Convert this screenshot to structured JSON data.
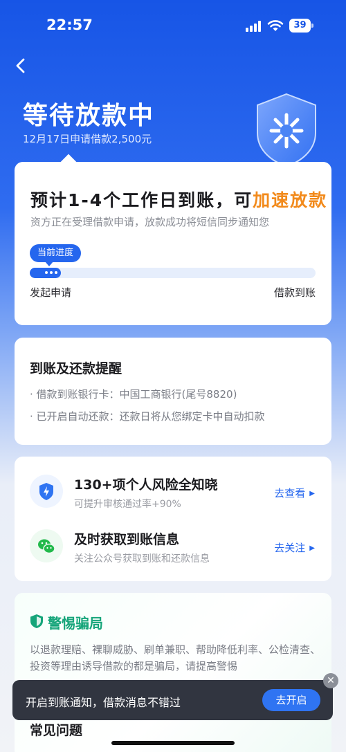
{
  "status_bar": {
    "time": "22:57",
    "battery": "39"
  },
  "header": {
    "title": "等待放款中",
    "subtitle": "12月17日申请借款2,500元"
  },
  "progress_card": {
    "headline": "预计1-4个工作日到账，可",
    "headline_accent": "加速放款",
    "description": "资方正在受理借款申请，放款成功将短信同步通知您",
    "current_label": "当前进度",
    "progress": 0.11,
    "stage_start": "发起申请",
    "stage_end": "借款到账"
  },
  "reminder_card": {
    "title": "到账及还款提醒",
    "items": [
      "· 借款到账银行卡：中国工商银行(尾号8820)",
      "· 已开启自动还款：还款日将从您绑定卡中自动扣款"
    ]
  },
  "service_card": {
    "rows": [
      {
        "icon": "shield-bolt-icon",
        "title": "130+项个人风险全知晓",
        "subtitle": "可提升审核通过率+90%",
        "link": "去查看"
      },
      {
        "icon": "wechat-icon",
        "title": "及时获取到账信息",
        "subtitle": "关注公众号获取到账和还款信息",
        "link": "去关注"
      }
    ]
  },
  "warning_card": {
    "title": "警惕骗局",
    "text": "以退款理赔、裸聊威胁、刷单兼职、帮助降低利率、公检清查、投资等理由诱导借款的都是骗局，请提高警惕"
  },
  "faq": {
    "title": "常见问题"
  },
  "toast": {
    "text": "开启到账通知，借款消息不错过",
    "button": "去开启",
    "close": "✕"
  },
  "colors": {
    "primary": "#2566ee",
    "accent": "#f28a1b",
    "safe_green": "#16a57a"
  }
}
